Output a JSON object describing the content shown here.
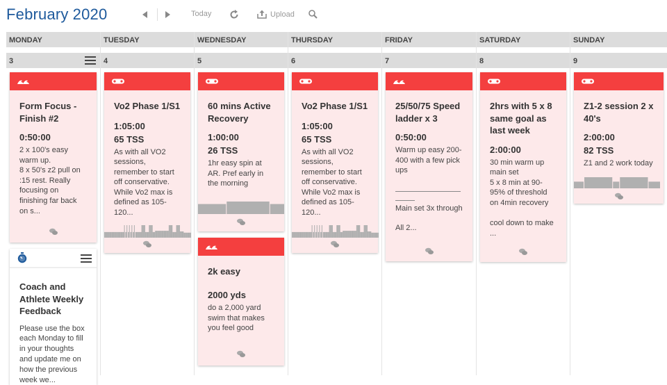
{
  "header": {
    "month": "February",
    "year": "2020",
    "today_label": "Today",
    "upload_label": "Upload",
    "accent": "#1e5a9c"
  },
  "colors": {
    "card_header": "#f43f3f",
    "card_bg": "#fde9ea",
    "chart_bar": "#b0b0b0"
  },
  "days": [
    {
      "name": "MONDAY",
      "num": "3"
    },
    {
      "name": "TUESDAY",
      "num": "4"
    },
    {
      "name": "WEDNESDAY",
      "num": "5"
    },
    {
      "name": "THURSDAY",
      "num": "6"
    },
    {
      "name": "FRIDAY",
      "num": "7"
    },
    {
      "name": "SATURDAY",
      "num": "8"
    },
    {
      "name": "SUNDAY",
      "num": "9"
    }
  ],
  "workouts": {
    "mon": {
      "sport": "swim",
      "title": "Form Focus - Finish #2",
      "duration": "0:50:00",
      "desc": "2 x 100's easy warm up.\n8 x 50's z2 pull on :15 rest. Really focusing on finishing far back on s..."
    },
    "tue": {
      "sport": "bike",
      "title": "Vo2 Phase 1/S1",
      "duration": "1:05:00",
      "tss": "65 TSS",
      "desc": "As with all VO2 sessions, remember to start off conservative. While Vo2 max is defined as 105-120...",
      "profile": [
        0.45,
        0.45,
        0.45,
        0.45,
        0.45,
        0.45,
        0.45,
        0.45,
        0.45,
        0.45,
        0.45,
        0.45,
        0.45,
        0.45,
        0.45,
        0.45,
        1,
        0.45,
        1,
        0.45,
        1,
        0.45,
        1,
        0.45,
        1,
        0.45,
        0.45,
        0.45,
        0.45,
        0.45,
        1,
        1,
        1,
        0.45,
        0.45,
        0.45,
        1,
        1,
        1,
        0.45,
        0.45,
        0.55,
        0.55,
        0.55,
        0.55,
        0.55,
        0.55,
        0.55,
        0.55,
        0.55,
        0.55,
        0.55,
        1,
        1,
        1,
        0.45,
        0.45,
        0.45,
        1,
        1,
        1,
        0.5,
        0.5,
        0.5,
        0.4,
        0.4,
        0.4,
        0.4,
        0.4,
        0.4
      ]
    },
    "wed": {
      "sport": "bike",
      "title": "60 mins Active Recovery",
      "duration": "1:00:00",
      "tss": "26 TSS",
      "desc": "1hr easy spin at AR. Pref early in the morning",
      "profile_blocks": [
        {
          "w": 0.33,
          "h": 0.8
        },
        {
          "w": 0.5,
          "h": 1
        },
        {
          "w": 0.17,
          "h": 0.8
        }
      ]
    },
    "wed2": {
      "sport": "swim",
      "title": "2k easy",
      "distance": "2000 yds",
      "desc": "do a 2,000 yard swim that makes you feel good"
    },
    "thu": {
      "sport": "bike",
      "title": "Vo2 Phase 1/S1",
      "duration": "1:05:00",
      "tss": "65 TSS",
      "desc": "As with all VO2 sessions, remember to start off conservative. While Vo2 max is defined as 105-120..."
    },
    "fri": {
      "sport": "swim",
      "title": "25/50/75 Speed ladder x 3",
      "duration": "0:50:00",
      "desc1": "Warm up easy 200-400 with a few pick ups",
      "desc2": "Main set 3x through",
      "desc3": "All 2..."
    },
    "sat": {
      "sport": "bike",
      "title": "2hrs with 5 x 8 same goal as last week",
      "duration": "2:00:00",
      "desc": "30 min warm up\nmain set\n5 x 8 min at 90-95% of threshold on 4min recovery\n\ncool down to make\n..."
    },
    "sun": {
      "sport": "bike",
      "title": "Z1-2 session 2 x 40's",
      "duration": "2:00:00",
      "tss": "82 TSS",
      "desc": "Z1 and 2 work today",
      "profile_blocks": [
        {
          "w": 0.12,
          "h": 0.6
        },
        {
          "w": 0.33,
          "h": 1
        },
        {
          "w": 0.08,
          "h": 0.6
        },
        {
          "w": 0.33,
          "h": 1
        },
        {
          "w": 0.14,
          "h": 0.6
        }
      ]
    }
  },
  "note": {
    "title": "Coach and Athlete Weekly Feedback",
    "desc": "Please use the box each Monday to fill in your thoughts and update me on how the previous week we..."
  }
}
